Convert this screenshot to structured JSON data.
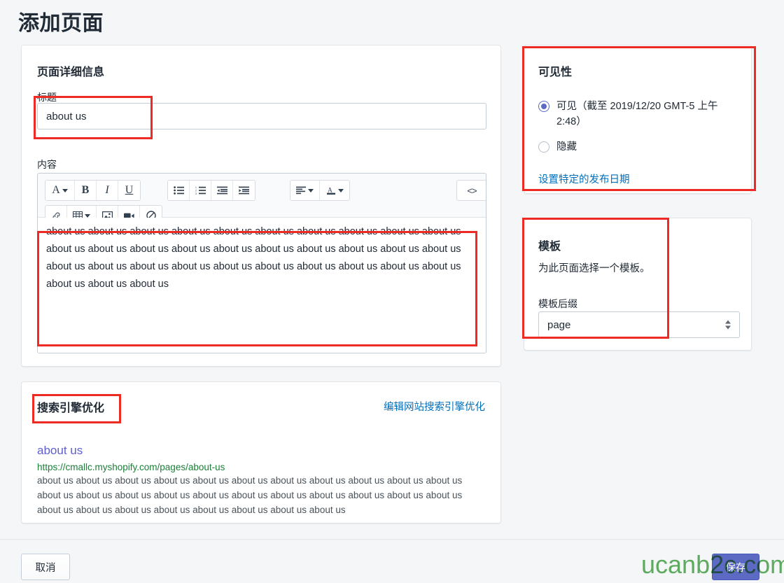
{
  "page": {
    "title": "添加页面",
    "background_color": "#f4f6f8",
    "accent_color": "#5c6ac4"
  },
  "details": {
    "heading": "页面详细信息",
    "title_label": "标题",
    "title_value": "about us",
    "title_placeholder": "",
    "content_label": "内容",
    "content_value": "about us  about us about us about us  about us about us about us  about us about us about us  about us about us about us  about us about us about us  about us about us about us  about us about us about us  about us about us about us  about us about us about us  about us about us about us  about us about us",
    "toolbar": {
      "groups": [
        {
          "name": "format-group",
          "buttons": [
            {
              "icon": "font-style-icon",
              "glyph": "A",
              "caret": true,
              "label": "字体样式"
            },
            {
              "icon": "bold-icon",
              "glyph": "B",
              "caret": false,
              "label": "粗体"
            },
            {
              "icon": "italic-icon",
              "glyph": "I",
              "caret": false,
              "label": "斜体"
            },
            {
              "icon": "underline-icon",
              "glyph": "U",
              "caret": false,
              "label": "下划线"
            }
          ]
        },
        {
          "name": "list-group",
          "buttons": [
            {
              "icon": "bulleted-list-icon",
              "glyph": "",
              "caret": false,
              "label": "项目符号列表"
            },
            {
              "icon": "numbered-list-icon",
              "glyph": "",
              "caret": false,
              "label": "编号列表"
            },
            {
              "icon": "outdent-icon",
              "glyph": "",
              "caret": false,
              "label": "减少缩进"
            },
            {
              "icon": "indent-icon",
              "glyph": "",
              "caret": false,
              "label": "增加缩进"
            }
          ]
        },
        {
          "name": "align-color-group",
          "buttons": [
            {
              "icon": "align-left-icon",
              "glyph": "",
              "caret": true,
              "label": "对齐"
            },
            {
              "icon": "text-color-icon",
              "glyph": "A",
              "caret": true,
              "label": "文本颜色"
            }
          ]
        },
        {
          "name": "insert-group",
          "buttons": [
            {
              "icon": "link-icon",
              "glyph": "",
              "caret": false,
              "label": "插入链接"
            },
            {
              "icon": "table-icon",
              "glyph": "",
              "caret": true,
              "label": "插入表格"
            },
            {
              "icon": "image-icon",
              "glyph": "",
              "caret": false,
              "label": "插入图片"
            },
            {
              "icon": "video-icon",
              "glyph": "",
              "caret": false,
              "label": "插入视频"
            },
            {
              "icon": "clear-formatting-icon",
              "glyph": "",
              "caret": false,
              "label": "清除格式"
            }
          ]
        }
      ],
      "html_button": {
        "icon": "code-icon",
        "glyph": "<>",
        "label": "显示 HTML"
      }
    }
  },
  "visibility": {
    "heading": "可见性",
    "options": [
      {
        "label": "可见（截至 2019/12/20 GMT-5 上午 2:48）",
        "selected": true
      },
      {
        "label": "隐藏",
        "selected": false
      }
    ],
    "publish_date_link": "设置特定的发布日期"
  },
  "template": {
    "heading": "模板",
    "description": "为此页面选择一个模板。",
    "suffix_label": "模板后缀",
    "suffix_value": "page"
  },
  "seo": {
    "heading": "搜索引擎优化",
    "edit_link": "编辑网站搜索引擎优化",
    "preview_title": "about us",
    "preview_url": "https://cmallc.myshopify.com/pages/about-us",
    "preview_description": "about us about us about us about us about us about us about us about us about us about us about us about us about us about us about us about us about us about us about us about us about us about us about us about us about us about us about us about us about us about us",
    "title_color": "#5f5fcf",
    "url_color": "#1a7f37"
  },
  "footer": {
    "cancel_label": "取消",
    "save_label": "保存"
  },
  "watermark": {
    "text": "ucanb2c.com",
    "color": "#3fa03f"
  }
}
